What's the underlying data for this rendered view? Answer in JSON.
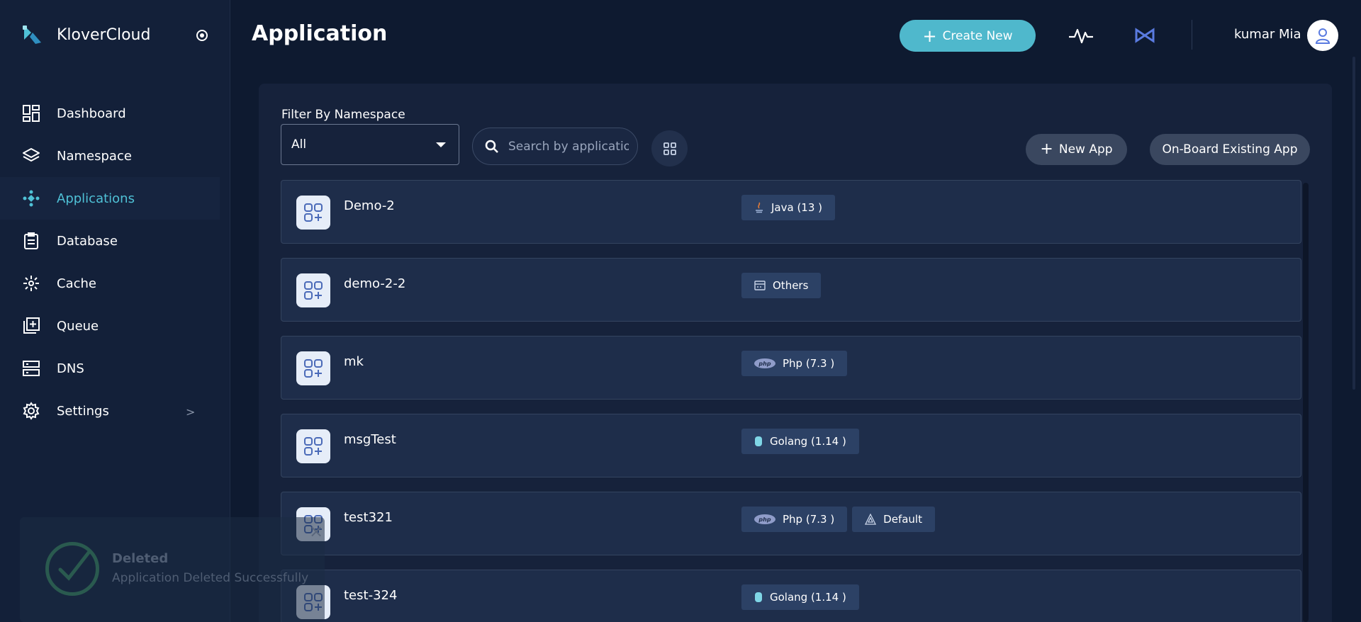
{
  "brand": {
    "name": "KloverCloud"
  },
  "sidebar": {
    "items": [
      {
        "label": "Dashboard",
        "icon": "dashboard-icon"
      },
      {
        "label": "Namespace",
        "icon": "layers-icon"
      },
      {
        "label": "Applications",
        "icon": "applications-icon",
        "active": true
      },
      {
        "label": "Database",
        "icon": "clipboard-icon"
      },
      {
        "label": "Cache",
        "icon": "cache-icon"
      },
      {
        "label": "Queue",
        "icon": "queue-icon"
      },
      {
        "label": "DNS",
        "icon": "server-icon"
      },
      {
        "label": "Settings",
        "icon": "gear-icon",
        "chevron": ">"
      }
    ]
  },
  "header": {
    "title": "Application",
    "create_label": "Create New",
    "user_name": "kumar Mia"
  },
  "filters": {
    "namespace_label": "Filter By Namespace",
    "namespace_value": "All",
    "search_placeholder": "Search by application"
  },
  "actions": {
    "new_app_label": "New App",
    "onboard_label": "On-Board Existing App"
  },
  "apps": [
    {
      "name": "Demo-2",
      "tags": [
        {
          "label": "Java (13 )",
          "icon": "java-icon"
        }
      ]
    },
    {
      "name": "demo-2-2",
      "tags": [
        {
          "label": "Others",
          "icon": "window-icon"
        }
      ]
    },
    {
      "name": "mk",
      "tags": [
        {
          "label": "Php (7.3 )",
          "icon": "php-icon"
        }
      ]
    },
    {
      "name": "msgTest",
      "tags": [
        {
          "label": "Golang (1.14 )",
          "icon": "golang-icon"
        }
      ]
    },
    {
      "name": "test321",
      "tags": [
        {
          "label": "Php (7.3 )",
          "icon": "php-icon"
        },
        {
          "label": "Default",
          "icon": "default-icon"
        }
      ]
    },
    {
      "name": "test-324",
      "tags": [
        {
          "label": "Golang (1.14 )",
          "icon": "golang-icon"
        }
      ]
    }
  ],
  "toast": {
    "title": "Deleted",
    "message": "Application Deleted Successfully"
  },
  "colors": {
    "accent": "#4fc1d6",
    "background": "#0e1a30",
    "sidebar": "#132039",
    "card": "#16223b",
    "row": "#1e2d4a",
    "tag": "#2c4165"
  }
}
